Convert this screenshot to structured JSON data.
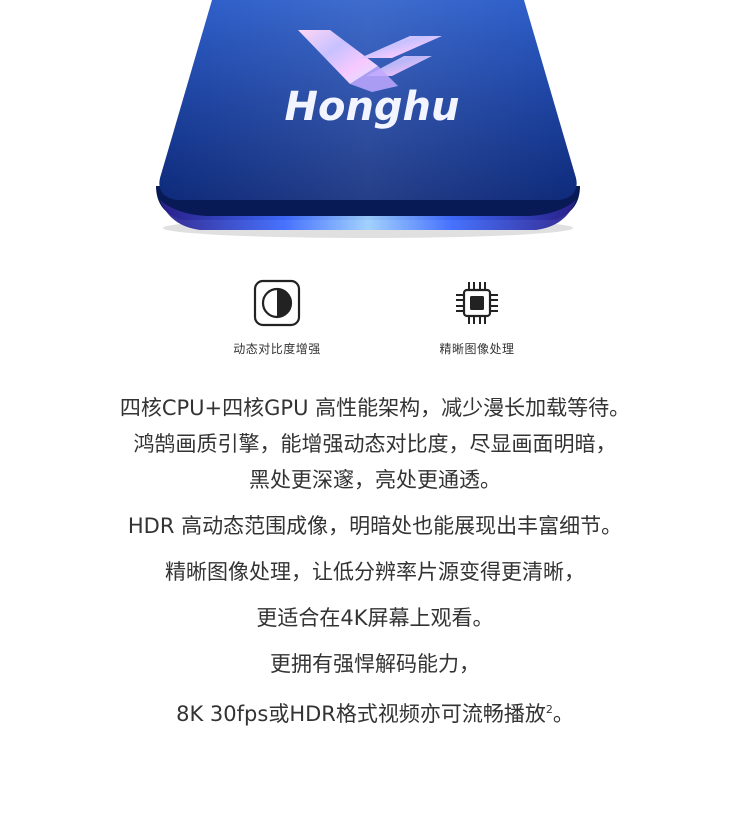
{
  "chip": {
    "brand": "Honghu",
    "colors": {
      "top": "#1e4aa8",
      "bottom": "#0a1c6a",
      "edge": "#3a7cff",
      "text": "#f2f4ff"
    }
  },
  "features": [
    {
      "icon": "contrast-icon",
      "label": "动态对比度增强"
    },
    {
      "icon": "chip-processor-icon",
      "label": "精晰图像处理"
    }
  ],
  "description": {
    "p1": [
      "四核CPU+四核GPU 高性能架构，减少漫长加载等待。",
      "鸿鹄画质引擎，能增强动态对比度，尽显画面明暗，",
      "黑处更深邃，亮处更通透。"
    ],
    "p2": [
      "HDR 高动态范围成像，明暗处也能展现出丰富细节。"
    ],
    "p3": [
      "精晰图像处理，让低分辨率片源变得更清晰，",
      "更适合在4K屏幕上观看。"
    ],
    "p4": [
      "更拥有强悍解码能力，",
      "8K 30fps或HDR格式视频亦可流畅播放"
    ],
    "footnote": "2",
    "tail": "。"
  }
}
